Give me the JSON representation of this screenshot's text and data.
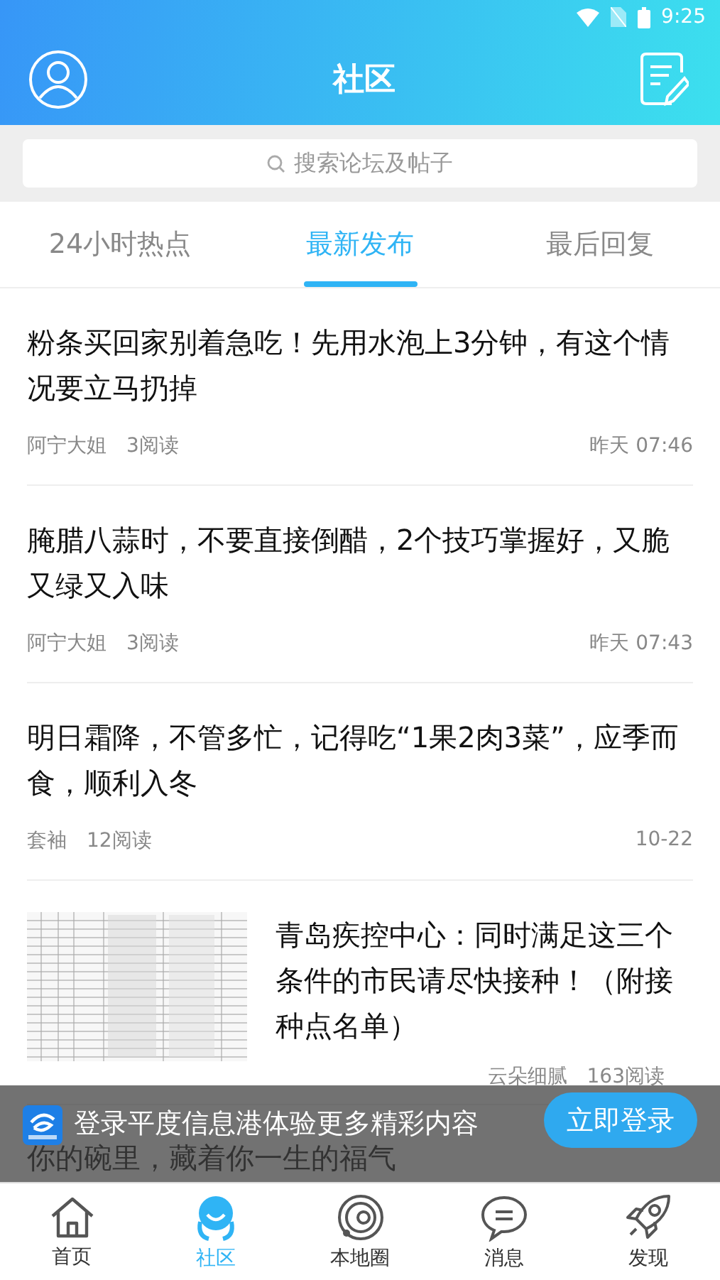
{
  "status_bar": {
    "time": "9:25"
  },
  "header": {
    "title": "社区"
  },
  "search": {
    "placeholder": "搜索论坛及帖子"
  },
  "tabs": [
    {
      "label": "24小时热点",
      "selected": false
    },
    {
      "label": "最新发布",
      "selected": true
    },
    {
      "label": "最后回复",
      "selected": false
    }
  ],
  "posts": [
    {
      "kind": "text",
      "title": "粉条买回家别着急吃！先用水泡上3分钟，有这个情况要立马扔掉",
      "author": "阿宁大姐",
      "reads": "3阅读",
      "time": "昨天 07:46"
    },
    {
      "kind": "text",
      "title": "腌腊八蒜时，不要直接倒醋，2个技巧掌握好，又脆又绿又入味",
      "author": "阿宁大姐",
      "reads": "3阅读",
      "time": "昨天 07:43"
    },
    {
      "kind": "text",
      "title": "明日霜降，不管多忙，记得吃“1果2肉3菜”，应季而食，顺利入冬",
      "author": "套袖",
      "reads": "12阅读",
      "time": "10-22"
    },
    {
      "kind": "thumb",
      "title": "青岛疾控中心：同时满足这三个条件的市民请尽快接种！（附接种点名单）",
      "author": "云朵细腻",
      "reads": "163阅读"
    },
    {
      "kind": "text",
      "title": "你的碗里，藏着你一生的福气"
    }
  ],
  "login_banner": {
    "text": "登录平度信息港体验更多精彩内容",
    "button": "立即登录"
  },
  "nav": [
    {
      "label": "首页",
      "selected": false
    },
    {
      "label": "社区",
      "selected": true
    },
    {
      "label": "本地圈",
      "selected": false
    },
    {
      "label": "消息",
      "selected": false
    },
    {
      "label": "发现",
      "selected": false
    }
  ]
}
